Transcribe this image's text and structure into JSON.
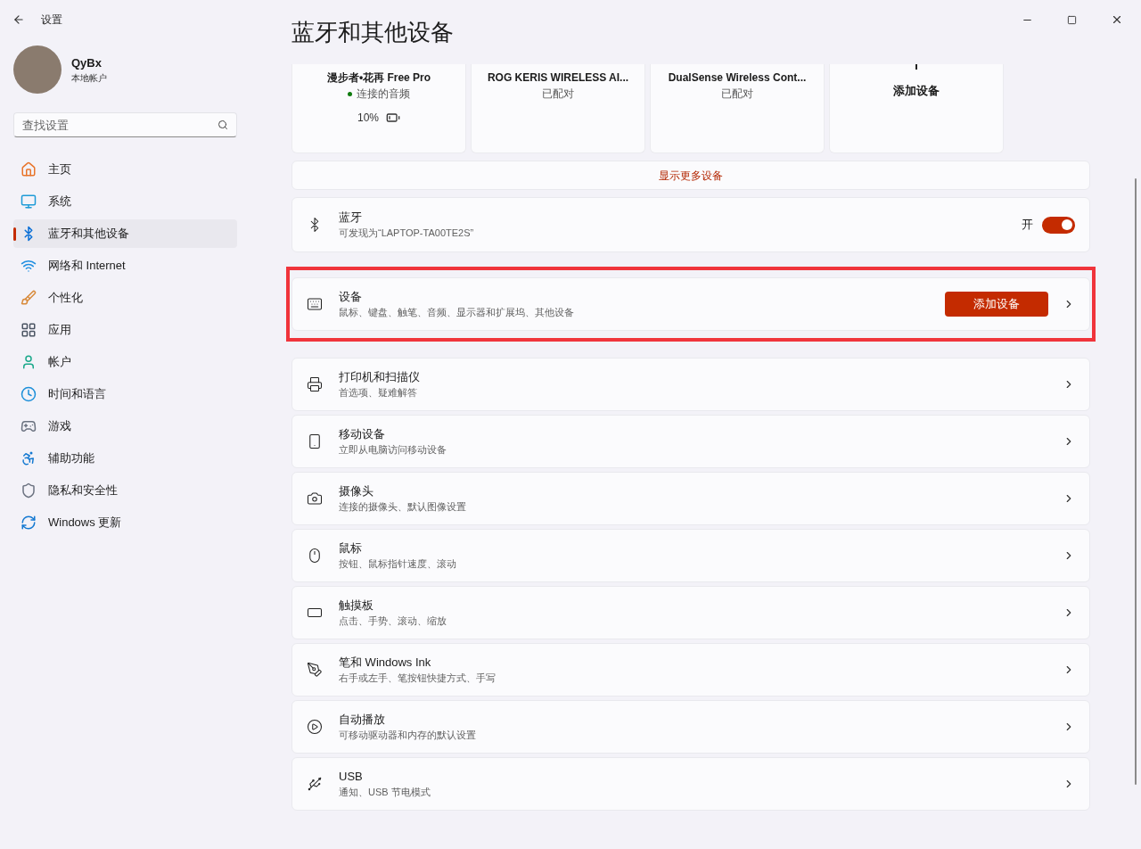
{
  "window": {
    "title": "设置"
  },
  "user": {
    "name": "QyBx",
    "account": "本地帐户"
  },
  "search": {
    "placeholder": "查找设置"
  },
  "sidebar": {
    "items": [
      {
        "kind": "home",
        "label": "主页",
        "selected": false
      },
      {
        "kind": "system",
        "label": "系统",
        "selected": false
      },
      {
        "kind": "bluetooth",
        "label": "蓝牙和其他设备",
        "selected": true
      },
      {
        "kind": "network",
        "label": "网络和 Internet",
        "selected": false
      },
      {
        "kind": "personalize",
        "label": "个性化",
        "selected": false
      },
      {
        "kind": "apps",
        "label": "应用",
        "selected": false
      },
      {
        "kind": "accounts",
        "label": "帐户",
        "selected": false
      },
      {
        "kind": "time",
        "label": "时间和语言",
        "selected": false
      },
      {
        "kind": "gaming",
        "label": "游戏",
        "selected": false
      },
      {
        "kind": "accessibility",
        "label": "辅助功能",
        "selected": false
      },
      {
        "kind": "privacy",
        "label": "隐私和安全性",
        "selected": false
      },
      {
        "kind": "update",
        "label": "Windows 更新",
        "selected": false
      }
    ]
  },
  "page_title": "蓝牙和其他设备",
  "device_cards": [
    {
      "kind": "device",
      "name": "漫步者•花再 Free Pro",
      "status": "连接的音频",
      "connected": true,
      "battery": "10%"
    },
    {
      "kind": "device",
      "name": "ROG KERIS WIRELESS AI...",
      "status": "已配对",
      "connected": false
    },
    {
      "kind": "device",
      "name": "DualSense Wireless Cont...",
      "status": "已配对",
      "connected": false
    },
    {
      "kind": "add",
      "name": "添加设备"
    }
  ],
  "show_more": "显示更多设备",
  "bluetooth": {
    "title": "蓝牙",
    "subtitle": "可发现为“LAPTOP-TA00TE2S”",
    "state_label": "开",
    "on": true
  },
  "rows": [
    {
      "kind": "keyboard",
      "title": "设备",
      "subtitle": "鼠标、键盘、触笔、音频、显示器和扩展坞、其他设备",
      "button": "添加设备",
      "highlighted": true
    },
    {
      "kind": "printer",
      "title": "打印机和扫描仪",
      "subtitle": "首选项、疑难解答",
      "highlighted": false
    },
    {
      "kind": "phone",
      "title": "移动设备",
      "subtitle": "立即从电脑访问移动设备",
      "highlighted": false
    },
    {
      "kind": "camera",
      "title": "摄像头",
      "subtitle": "连接的摄像头、默认图像设置",
      "highlighted": false
    },
    {
      "kind": "mouse",
      "title": "鼠标",
      "subtitle": "按钮、鼠标指针速度、滚动",
      "highlighted": false
    },
    {
      "kind": "touchpad",
      "title": "触摸板",
      "subtitle": "点击、手势、滚动、缩放",
      "highlighted": false
    },
    {
      "kind": "pen",
      "title": "笔和 Windows Ink",
      "subtitle": "右手或左手、笔按钮快捷方式、手写",
      "highlighted": false
    },
    {
      "kind": "autoplay",
      "title": "自动播放",
      "subtitle": "可移动驱动器和内存的默认设置",
      "highlighted": false
    },
    {
      "kind": "usb",
      "title": "USB",
      "subtitle": "通知、USB 节电模式",
      "highlighted": false
    }
  ]
}
